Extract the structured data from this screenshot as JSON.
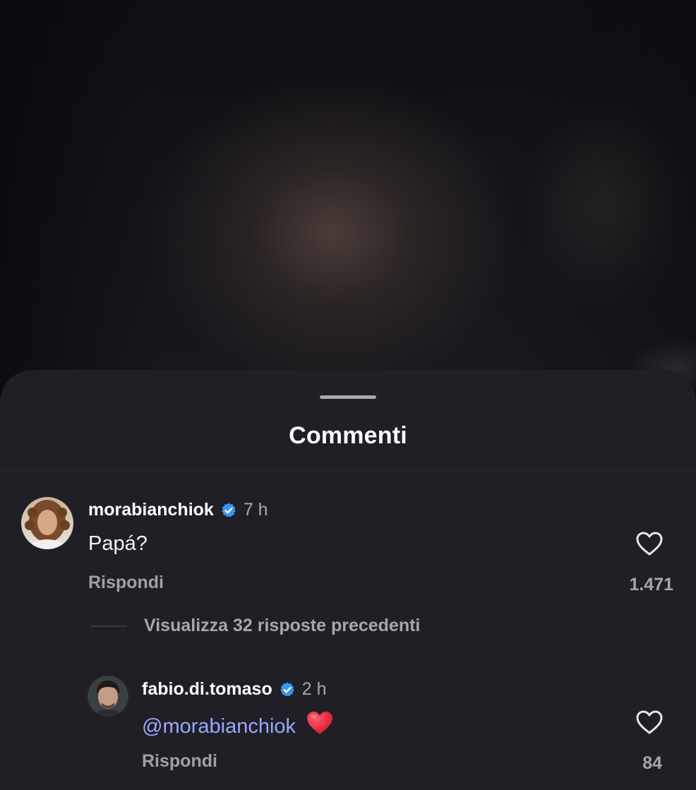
{
  "sheet": {
    "title": "Commenti"
  },
  "comments": [
    {
      "username": "morabianchiok",
      "verified": true,
      "time": "7 h",
      "text": "Papá?",
      "reply_label": "Rispondi",
      "likes": "1.471",
      "avatar_icon": "avatar-woman-curly-hair"
    }
  ],
  "view_replies": {
    "label": "Visualizza 32 risposte precedenti"
  },
  "replies": [
    {
      "username": "fabio.di.tomaso",
      "verified": true,
      "time": "2 h",
      "mention": "@morabianchiok",
      "emoji": "red-heart",
      "reply_label": "Rispondi",
      "likes": "84",
      "avatar_icon": "avatar-man-dark-hair"
    }
  ],
  "colors": {
    "sheet_bg": "#1f1f25",
    "verified_badge": "#3797f0",
    "mention": "#9aa8ff",
    "heart": "#e0243a"
  }
}
